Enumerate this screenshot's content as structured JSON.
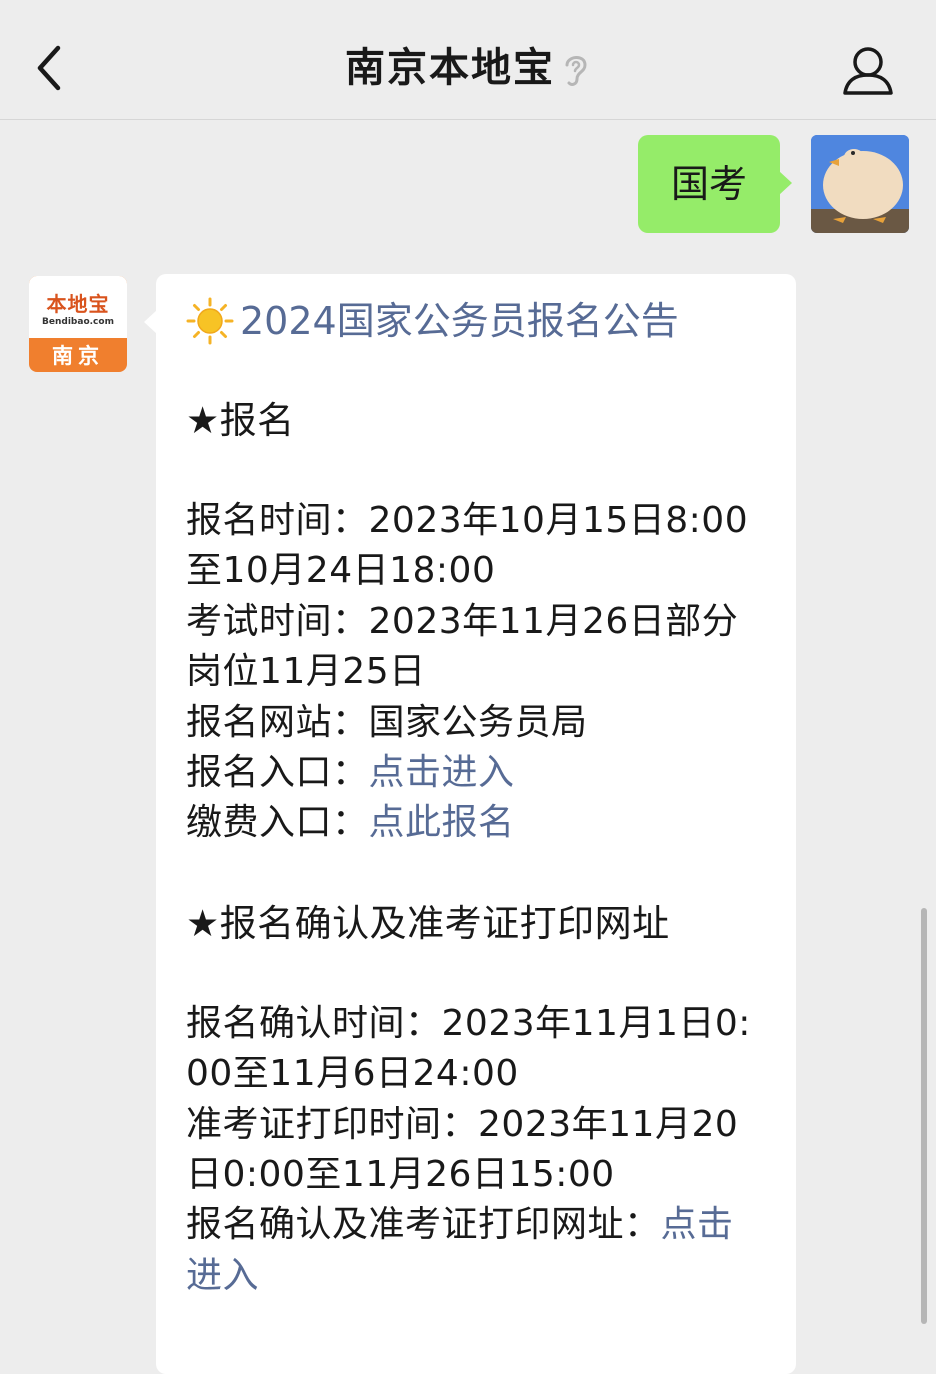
{
  "header": {
    "title": "南京本地宝",
    "back_icon": "chevron-left-icon",
    "listen_icon": "ear-icon",
    "profile_icon": "person-icon"
  },
  "outgoing": {
    "text": "国考"
  },
  "official_avatar": {
    "brand": "本地宝",
    "domain": "Bendibao.com",
    "city": "南京"
  },
  "message": {
    "title_icon": "sun-emoji-icon",
    "title": "2024国家公务员报名公告",
    "sections": [
      {
        "heading": "★报名",
        "items": [
          {
            "label": "报名时间：",
            "value": "2023年10月15日8:00至10月24日18:00"
          },
          {
            "label": "考试时间：",
            "value": "2023年11月26日部分岗位11月25日"
          },
          {
            "label": "报名网站：",
            "value": "国家公务员局"
          },
          {
            "label": "报名入口：",
            "link": "点击进入"
          },
          {
            "label": "缴费入口：",
            "link": "点此报名"
          }
        ]
      },
      {
        "heading": "★报名确认及准考证打印网址",
        "items": [
          {
            "label": "报名确认时间：",
            "value": "2023年11月1日0:00至11月6日24:00"
          },
          {
            "label": "准考证打印时间：",
            "value": "2023年11月20日0:00至11月26日15:00"
          },
          {
            "label": "报名确认及准考证打印网址：",
            "link": "点击进入"
          }
        ]
      }
    ]
  },
  "colors": {
    "outgoing_bubble": "#95ec69",
    "link": "#576b95",
    "background": "#ededed",
    "brand_orange": "#f07f2e"
  }
}
